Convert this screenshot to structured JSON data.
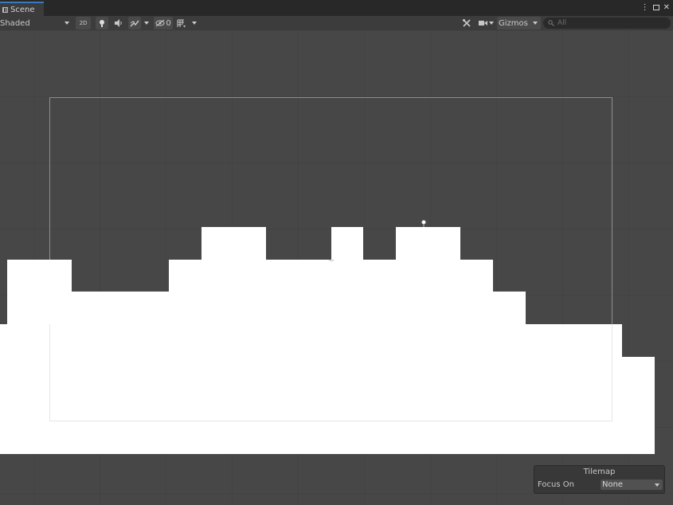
{
  "window": {
    "tab_label": "Scene",
    "controls": {
      "more": "⋮",
      "close": "✕"
    }
  },
  "toolbar": {
    "shading_mode": "Shaded",
    "mode_2d_label": "2D",
    "hidden_count": "0",
    "gizmos_label": "Gizmos",
    "search_placeholder": "All",
    "icons": [
      "lighting-icon",
      "audio-icon",
      "effects-icon",
      "visibility-icon",
      "grid-icon",
      "tools-icon",
      "camera-icon",
      "search-icon"
    ]
  },
  "scene": {
    "background_color": "#474747",
    "tile_color": "#ffffff",
    "camera_frame_color": "#8e8e8e"
  },
  "overlay": {
    "title": "Tilemap",
    "focus_label": "Focus On",
    "focus_value": "None"
  }
}
